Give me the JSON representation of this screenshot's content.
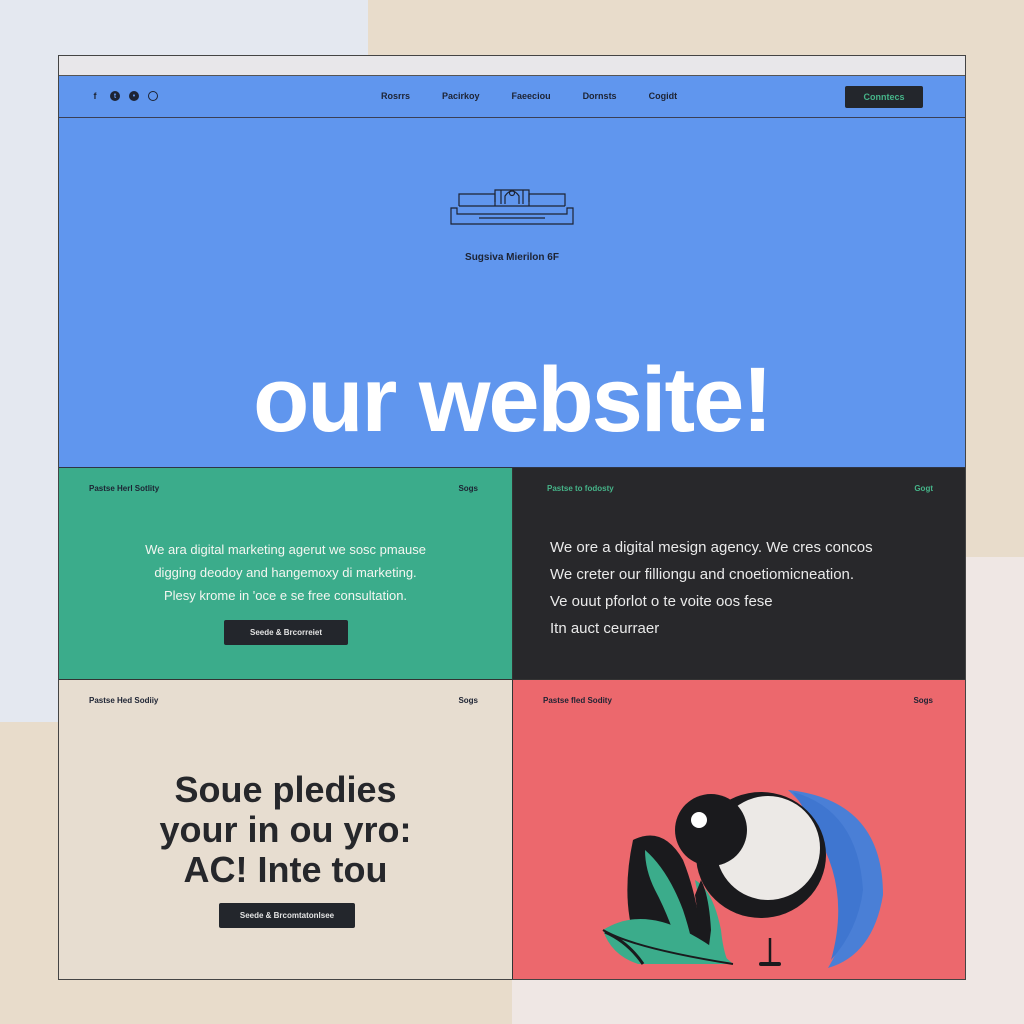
{
  "colors": {
    "hero_blue": "#6096ee",
    "green": "#3bac8b",
    "dark": "#28282b",
    "beige": "#e7ddd0",
    "coral": "#ec686d",
    "button_dark": "#23262c"
  },
  "nav": {
    "social_icons": [
      "facebook-icon",
      "twitter-icon",
      "dribbble-icon",
      "instagram-icon"
    ],
    "links": [
      "Rosrrs",
      "Pacirkoy",
      "Faeeciou",
      "Dornsts",
      "Cogidt"
    ],
    "cta_label": "Conntecs"
  },
  "hero": {
    "logo_icon": "building-logo-icon",
    "subtitle": "Sugsiva Mierilon 6F",
    "title": "our website!"
  },
  "panel_green": {
    "tag": "Pastse Herl Sotlity",
    "corner": "Sogs",
    "lines": [
      "We ara digital marketing agerut we sosc pmause",
      "digging deodoy and hangemoxy di marketing.",
      "Plesy krome in 'oce e se free consultation."
    ],
    "button_label": "Seede & Brcorreiet"
  },
  "panel_dark": {
    "tag": "Pastse to fodosty",
    "corner": "Gogt",
    "lines": [
      "We ore a digital mesign agency. We cres concos",
      "We creter our filliongu and cnoetiomicneation.",
      "Ve ouut pforlot o te voite oos fese",
      "Itn auct ceurraer"
    ]
  },
  "panel_beige": {
    "tag": "Pastse Hed Sodiiy",
    "corner": "Sogs",
    "title_lines": [
      "Soue pledies",
      "your in ou yro:",
      "AC! Inte tou"
    ],
    "button_label": "Seede & Brcomtatonlsee"
  },
  "panel_red": {
    "tag": "Pastse fled Sodity",
    "corner": "Sogs",
    "illustration_icon": "bird-illustration"
  }
}
